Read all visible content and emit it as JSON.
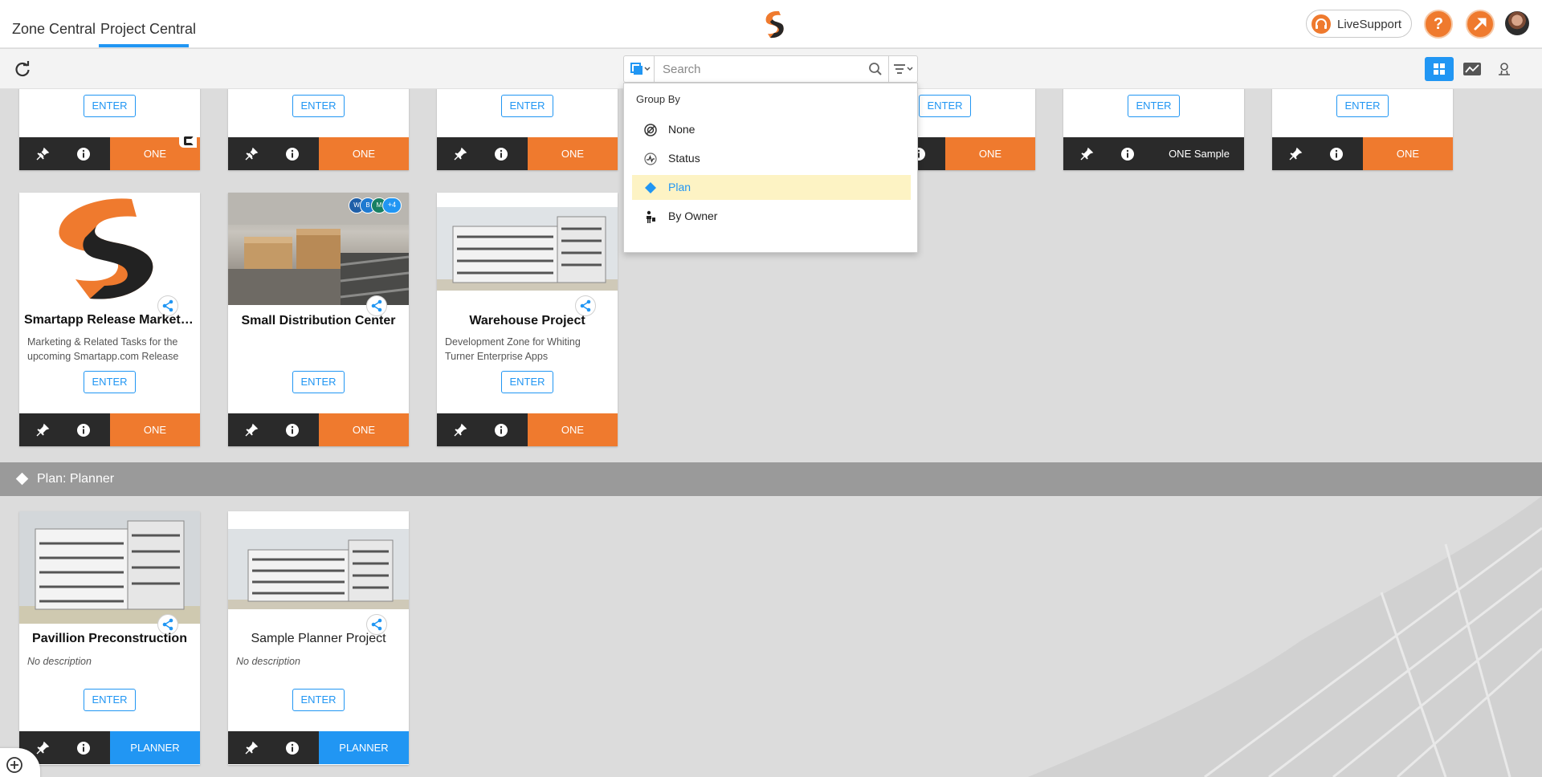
{
  "nav": {
    "tabs": [
      {
        "label": "Zone Central",
        "active": false
      },
      {
        "label": "Project Central",
        "active": true
      }
    ],
    "live_support": "LiveSupport",
    "help_icon": "question-icon",
    "wrench_icon": "wrench-icon"
  },
  "toolbar": {
    "search_placeholder": "Search",
    "view_modes": [
      "grid-view",
      "chart-view",
      "person-view"
    ],
    "active_view": "grid-view"
  },
  "group_by": {
    "title": "Group By",
    "options": [
      {
        "label": "None",
        "icon": "none-icon"
      },
      {
        "label": "Status",
        "icon": "status-icon"
      },
      {
        "label": "Plan",
        "icon": "diamond-icon",
        "selected": true
      },
      {
        "label": "By Owner",
        "icon": "owner-icon"
      }
    ]
  },
  "top_row": [
    {
      "enter": "ENTER",
      "plan": "ONE"
    },
    {
      "enter": "ENTER",
      "plan": "ONE"
    },
    {
      "enter": "ENTER",
      "plan": "ONE"
    },
    {
      "enter": "ENTER",
      "plan": "ONE"
    },
    {
      "enter": "ENTER",
      "plan": "ONE Sample"
    },
    {
      "enter": "ENTER",
      "plan": "ONE"
    }
  ],
  "one_row": [
    {
      "title": "Smartapp Release Marketing Tasks",
      "desc": "Marketing & Related Tasks for the upcoming Smartapp.com Release",
      "enter": "ENTER",
      "plan": "ONE"
    },
    {
      "title": "Small Distribution Center",
      "desc": "",
      "enter": "ENTER",
      "plan": "ONE",
      "members": [
        "W",
        "B",
        "M",
        "+4"
      ]
    },
    {
      "title": "Warehouse Project",
      "desc": "Development Zone for Whiting Turner Enterprise Apps",
      "enter": "ENTER",
      "plan": "ONE"
    }
  ],
  "planner_group": {
    "label": "Plan: Planner",
    "cards": [
      {
        "title": "Pavillion Preconstruction",
        "desc": "No description",
        "enter": "ENTER",
        "plan": "PLANNER"
      },
      {
        "title": "Sample Planner Project",
        "desc": "No description",
        "enter": "ENTER",
        "plan": "PLANNER"
      }
    ]
  },
  "colors": {
    "accent": "#2196f3",
    "brand_orange": "#ef7a2e",
    "footer_dark": "#2a2a2a",
    "selected_bg": "#fdf3c4"
  }
}
